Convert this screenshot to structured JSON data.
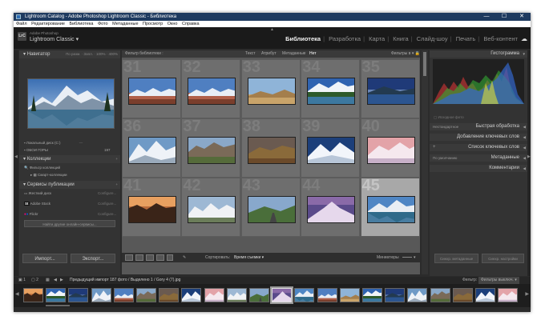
{
  "window": {
    "title": "Lightroom Catalog - Adobe Photoshop Lightroom Classic - Библиотека",
    "controls": [
      "—",
      "☐",
      "✕"
    ]
  },
  "menu": [
    "Файл",
    "Редактирование",
    "Библиотека",
    "Фото",
    "Метаданные",
    "Просмотр",
    "Окно",
    "Справка"
  ],
  "identity": {
    "logo": "LrC",
    "brand_line1": "Adobe Photoshop",
    "brand_line2": "Lightroom Classic",
    "modules": [
      "Библиотека",
      "Разработка",
      "Карта",
      "Книга",
      "Слайд-шоу",
      "Печать",
      "Веб-контент"
    ],
    "active_module": "Библиотека"
  },
  "left_panel": {
    "navigator_title": "Навигатор",
    "navigator_options": [
      "По разм.",
      "Запл.",
      "100%",
      "400%"
    ],
    "folders_rows": [
      "Локальный диск (C:)",
      "ОБОИ ГОРЫ"
    ],
    "folders_value": "197",
    "collections_title": "Коллекции",
    "collection_filter": "Фильтр коллекций",
    "smart_collections": "Смарт-коллекции",
    "publish_title": "Сервисы публикации",
    "publish_services": [
      "Жесткий диск",
      "Adobe Stock",
      "Flickr"
    ],
    "publish_setup": "Configure...",
    "find_more": "Найти другие онлайн-сервисы...",
    "import_btn": "Импорт...",
    "export_btn": "Экспорт..."
  },
  "filter_bar": {
    "title": "Фильтр библиотеки :",
    "options": [
      "Текст",
      "Атрибут",
      "Метаданные",
      "Нет"
    ],
    "active": "Нет",
    "preset": "Фильтры в"
  },
  "grid": {
    "cells": [
      {
        "num": "31",
        "scene": "canyon"
      },
      {
        "num": "32",
        "scene": "canyon"
      },
      {
        "num": "33",
        "scene": "desert"
      },
      {
        "num": "34",
        "scene": "lake-forest"
      },
      {
        "num": "35",
        "scene": "dusk-lake"
      },
      {
        "num": "36",
        "scene": "snow-mountain"
      },
      {
        "num": "37",
        "scene": "rocky-valley"
      },
      {
        "num": "38",
        "scene": "autumn-ridge"
      },
      {
        "num": "39",
        "scene": "winter-peak"
      },
      {
        "num": "40",
        "scene": "pink-snow"
      },
      {
        "num": "41",
        "scene": "sunset-cliff"
      },
      {
        "num": "42",
        "scene": "alpine-range"
      },
      {
        "num": "43",
        "scene": "mountain-road"
      },
      {
        "num": "44",
        "scene": "purple-peak"
      },
      {
        "num": "45",
        "scene": "mountain-lake"
      }
    ],
    "selected_index": 14
  },
  "toolbar": {
    "sort_label": "Сортировать:",
    "sort_value": "Время съемки",
    "thumbnails_label": "Миниатюры"
  },
  "right_panel": {
    "histogram_title": "Гистограмма",
    "histogram_footer": "Исходное фото",
    "rows": [
      "Быстрая обработка",
      "Добавление ключевых слов",
      "Список ключевых слов",
      "Метаданные",
      "Комментарии"
    ],
    "quick_left": "Нестандартное",
    "meta_left": "По умолчанию",
    "sync_meta": "Синхр. метаданные",
    "sync_settings": "Синхр. настройки"
  },
  "filmstrip": {
    "page_buttons": [
      "1",
      "2"
    ],
    "info": "Предыдущий импорт  187 фото / Выделено 1 / Gory 4 (7).jpg",
    "filter_label": "Фильтр:",
    "filter_value": "Фильтры выключ.",
    "scenes": [
      "sunset-cliff",
      "lake-forest",
      "dusk-lake",
      "snow-mountain",
      "canyon",
      "rocky-valley",
      "autumn-ridge",
      "winter-peak",
      "pink-snow",
      "alpine-range",
      "mountain-road",
      "purple-peak",
      "mountain-lake",
      "canyon",
      "desert",
      "lake-forest",
      "dusk-lake",
      "snow-mountain",
      "rocky-valley",
      "autumn-ridge",
      "winter-peak",
      "pink-snow"
    ],
    "current_index": 11
  },
  "colors": {
    "accent": "#ffffff",
    "panel": "#333333",
    "grid_bg": "#585858"
  }
}
